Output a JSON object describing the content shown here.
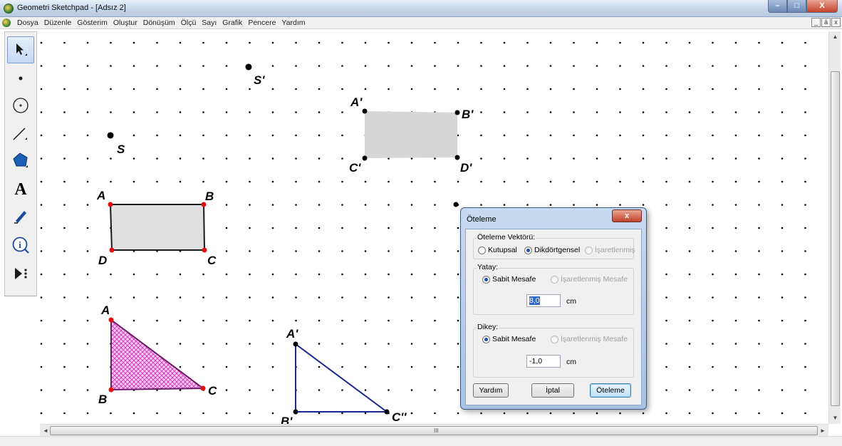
{
  "window": {
    "title": "Geometri Sketchpad - [Adsız 2]",
    "minimize_label": "–",
    "maximize_label": "□",
    "close_label": "X"
  },
  "menu": {
    "items": [
      "Dosya",
      "Düzenle",
      "Gösterim",
      "Oluştur",
      "Dönüşüm",
      "Ölçü",
      "Sayı",
      "Grafik",
      "Pencere",
      "Yardım"
    ],
    "mdi": [
      "_",
      "ā",
      "x"
    ]
  },
  "toolbox": {
    "tools": [
      "arrow-tool",
      "point-tool",
      "compass-tool",
      "straightedge-tool",
      "polygon-tool",
      "text-tool",
      "marker-tool",
      "information-tool",
      "custom-tool"
    ],
    "text_tool_glyph": "A"
  },
  "canvas": {
    "labels": {
      "s_prime": "S'",
      "s": "S",
      "rect_a": "A",
      "rect_b": "B",
      "rect_c": "C",
      "rect_d": "D",
      "rectp_a": "A'",
      "rectp_b": "B'",
      "rectp_c": "C'",
      "rectp_d": "D'",
      "tri_a": "A",
      "tri_b": "B",
      "tri_c": "C",
      "trip_a": "A'",
      "trip_b": "B'",
      "trip_c": "C''"
    },
    "colors": {
      "grid_dot": "#000000",
      "rect_fill": "#e0e0e0",
      "rect_prime_fill": "#d6d6d6",
      "triangle_fill": "#e86ad0",
      "triangle_prime_stroke": "#1a2a8c",
      "vertex_red": "#e01010"
    }
  },
  "dialog": {
    "title": "Öteleme",
    "close_label": "x",
    "vector_group": {
      "title": "Öteleme Vektörü:",
      "options": [
        "Kutupsal",
        "Dikdörtgensel",
        "İşaretlenmiş"
      ],
      "selected": "Dikdörtgensel"
    },
    "horizontal": {
      "title": "Yatay:",
      "options": [
        "Sabit Mesafe",
        "İşaretlenmiş Mesafe"
      ],
      "selected": "Sabit Mesafe",
      "value": "8,0",
      "unit": "cm"
    },
    "vertical": {
      "title": "Dikey:",
      "options": [
        "Sabit Mesafe",
        "İşaretlenmiş Mesafe"
      ],
      "selected": "Sabit Mesafe",
      "value": "-1,0",
      "unit": "cm"
    },
    "buttons": {
      "help": "Yardım",
      "cancel": "İptal",
      "ok": "Öteleme"
    }
  },
  "scroll": {
    "up": "▲",
    "down": "▼",
    "left": "◄",
    "right": "►",
    "grip": "III"
  }
}
